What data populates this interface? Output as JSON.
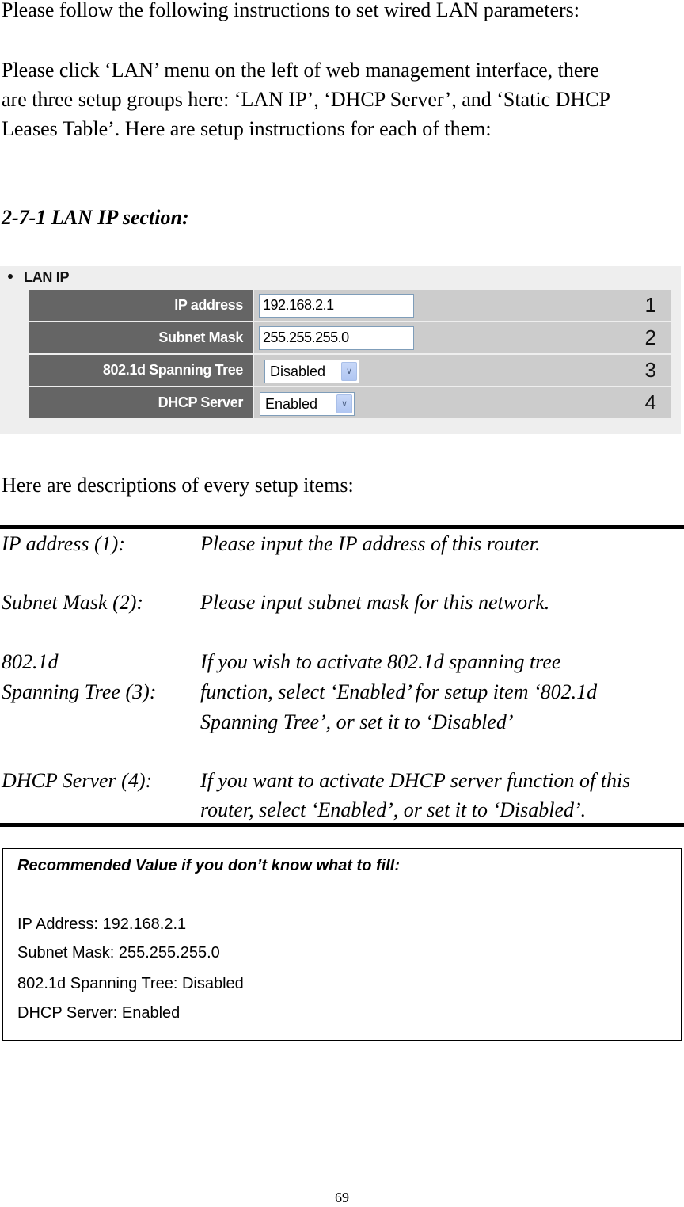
{
  "intro": {
    "line1": "Please follow the following instructions to set wired LAN parameters:",
    "paragraph": [
      "Please click ‘LAN’ menu on the left of web management interface, there",
      "are three setup groups here: ‘LAN IP’, ‘DHCP Server’, and ‘Static DHCP",
      "Leases Table’. Here are setup instructions for each of them:"
    ]
  },
  "section_heading": "2-7-1 LAN IP section:",
  "lan_panel": {
    "title": "LAN IP",
    "rows": [
      {
        "label": "IP address",
        "type": "text",
        "value": "192.168.2.1",
        "marker": "1"
      },
      {
        "label": "Subnet Mask",
        "type": "text",
        "value": "255.255.255.0",
        "marker": "2"
      },
      {
        "label": "802.1d Spanning Tree",
        "type": "select",
        "value": "Disabled",
        "marker": "3"
      },
      {
        "label": "DHCP Server",
        "type": "select",
        "value": "Enabled",
        "marker": "4"
      }
    ],
    "dropdown_icon": "chevron-down-icon"
  },
  "items_intro": "Here are descriptions of every setup items:",
  "descriptions": [
    {
      "term": [
        "IP address (1):"
      ],
      "definition": [
        "Please input the IP address of this router."
      ]
    },
    {
      "term": [
        "Subnet Mask (2):"
      ],
      "definition": [
        "Please input subnet mask for this network."
      ]
    },
    {
      "term": [
        "802.1d",
        "Spanning Tree (3):"
      ],
      "definition": [
        "If you wish to activate 802.1d spanning tree",
        "function, select ‘Enabled’ for setup item ‘802.1d",
        "Spanning Tree’, or set it to ‘Disabled’"
      ]
    },
    {
      "term": [
        "DHCP Server (4):"
      ],
      "definition": [
        "If you want to activate DHCP server function of this",
        "router, select ‘Enabled’, or set it to ‘Disabled’."
      ]
    }
  ],
  "recommended": {
    "title": "Recommended Value if you don’t know what to fill:",
    "lines": [
      "IP Address: 192.168.2.1",
      "Subnet Mask: 255.255.255.0",
      "802.1d Spanning Tree: Disabled",
      "DHCP Server: Enabled"
    ]
  },
  "page_number": "69"
}
